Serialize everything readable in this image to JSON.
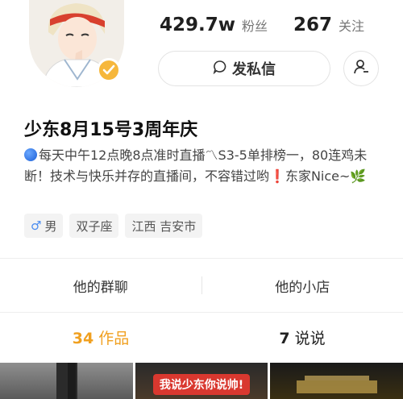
{
  "profile": {
    "followers_count": "429.7w",
    "followers_label": "粉丝",
    "following_count": "267",
    "following_label": "关注",
    "dm_label": "发私信",
    "name": "少东8月15号3周年庆",
    "bio_line": "每天中午12点晚8点准时直播〽S3-5单排榜一，80连鸡未断！技术与快乐并存的直播间，不容错过哟",
    "bio_tail": "东家Nice~🌿",
    "bio_bang": "❗",
    "tags": {
      "gender_symbol": "♂",
      "gender": "男",
      "zodiac": "双子座",
      "location": "江西 吉安市"
    }
  },
  "links": {
    "group_chat": "他的群聊",
    "shop": "他的小店"
  },
  "tabs": {
    "works_count": "34",
    "works_label": "作品",
    "talks_count": "7",
    "talks_label": "说说"
  },
  "thumbnails": {
    "thumb2_banner": "我说少东你说帅!"
  },
  "colors": {
    "accent": "#f0a020",
    "verified_badge": "#f6b73c"
  }
}
